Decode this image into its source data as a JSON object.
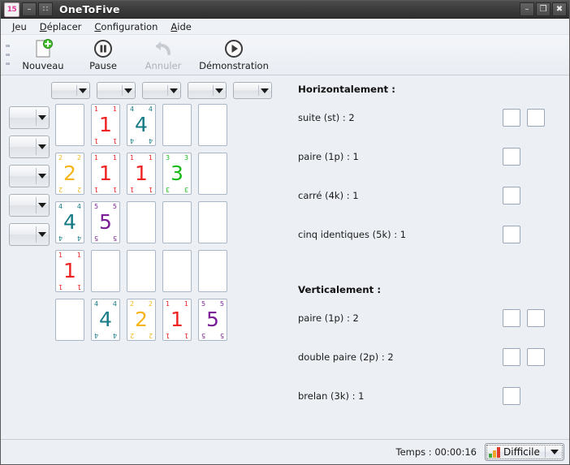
{
  "window": {
    "title": "OneToFive",
    "icon_label": "15",
    "icon_name": "card-15-icon",
    "buttons": {
      "shade_label": "–",
      "menu_label": "∷",
      "minimize_label": "–",
      "maximize_label": "❐",
      "close_label": "✖"
    }
  },
  "menubar": {
    "items": [
      {
        "mnemonic": "J",
        "rest": "eu"
      },
      {
        "mnemonic": "D",
        "rest": "éplacer"
      },
      {
        "mnemonic": "C",
        "rest": "onfiguration"
      },
      {
        "mnemonic": "A",
        "rest": "ide"
      }
    ]
  },
  "toolbar": {
    "items": [
      {
        "label": "Nouveau",
        "icon": "new-document-icon",
        "disabled": false
      },
      {
        "label": "Pause",
        "icon": "pause-icon",
        "disabled": false
      },
      {
        "label": "Annuler",
        "icon": "undo-arrow-icon",
        "disabled": true
      },
      {
        "label": "Démonstration",
        "icon": "play-icon",
        "disabled": false
      }
    ]
  },
  "board": {
    "column_selector_count": 5,
    "row_selector_count": 5,
    "card_colors": {
      "1": "#ee2222",
      "2": "#f5b51a",
      "3": "#18b818",
      "4": "#147b86",
      "5": "#7b1d96"
    },
    "grid": [
      [
        null,
        "1",
        "4",
        null,
        null
      ],
      [
        "2",
        "1",
        "1",
        "3",
        null
      ],
      [
        "4",
        "5",
        null,
        null,
        null
      ],
      [
        "1",
        null,
        null,
        null,
        null
      ],
      [
        null,
        "4",
        "2",
        "1",
        "5"
      ]
    ]
  },
  "info": {
    "horizontal_title": "Horizontalement :",
    "vertical_title": "Verticalement :",
    "horizontal_rules": [
      {
        "label": "suite (st) : 2",
        "boxes": 2
      },
      {
        "label": "paire (1p) : 1",
        "boxes": 1
      },
      {
        "label": "carré (4k) : 1",
        "boxes": 1
      },
      {
        "label": "cinq identiques (5k) : 1",
        "boxes": 1
      }
    ],
    "vertical_rules": [
      {
        "label": "paire (1p) : 2",
        "boxes": 2
      },
      {
        "label": "double paire (2p) : 2",
        "boxes": 2
      },
      {
        "label": "brelan (3k) : 1",
        "boxes": 1
      }
    ]
  },
  "statusbar": {
    "time_label": "Temps :  00:00:16",
    "difficulty": "Difficile"
  }
}
